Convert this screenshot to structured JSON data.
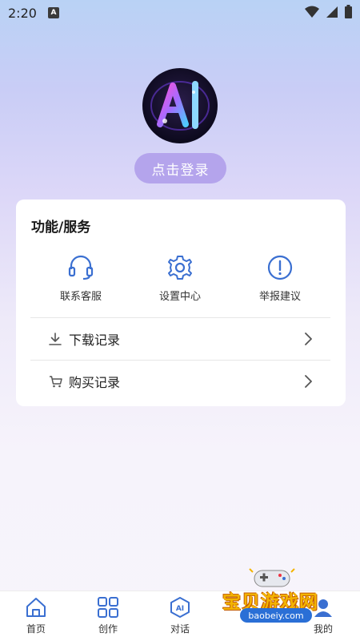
{
  "status_bar": {
    "time": "2:20",
    "app_badge": "A"
  },
  "profile": {
    "login_label": "点击登录",
    "avatar_text": "AI"
  },
  "services": {
    "title": "功能/服务",
    "items": [
      {
        "label": "联系客服",
        "icon": "headset-icon"
      },
      {
        "label": "设置中心",
        "icon": "gear-icon"
      },
      {
        "label": "举报建议",
        "icon": "alert-icon"
      }
    ]
  },
  "records": [
    {
      "label": "下载记录",
      "icon": "download-icon"
    },
    {
      "label": "购买记录",
      "icon": "cart-icon"
    }
  ],
  "bottom_nav": [
    {
      "label": "首页",
      "icon": "home-icon"
    },
    {
      "label": "创作",
      "icon": "grid-icon"
    },
    {
      "label": "对话",
      "icon": "ai-chat-icon",
      "badge": "AI"
    },
    {
      "label": "我的",
      "icon": "profile-icon"
    }
  ],
  "watermark": {
    "text": "宝贝游戏网",
    "url": "baobeiy.com"
  },
  "colors": {
    "accent": "#b4a4ec",
    "icon_blue": "#3a6fd1"
  }
}
